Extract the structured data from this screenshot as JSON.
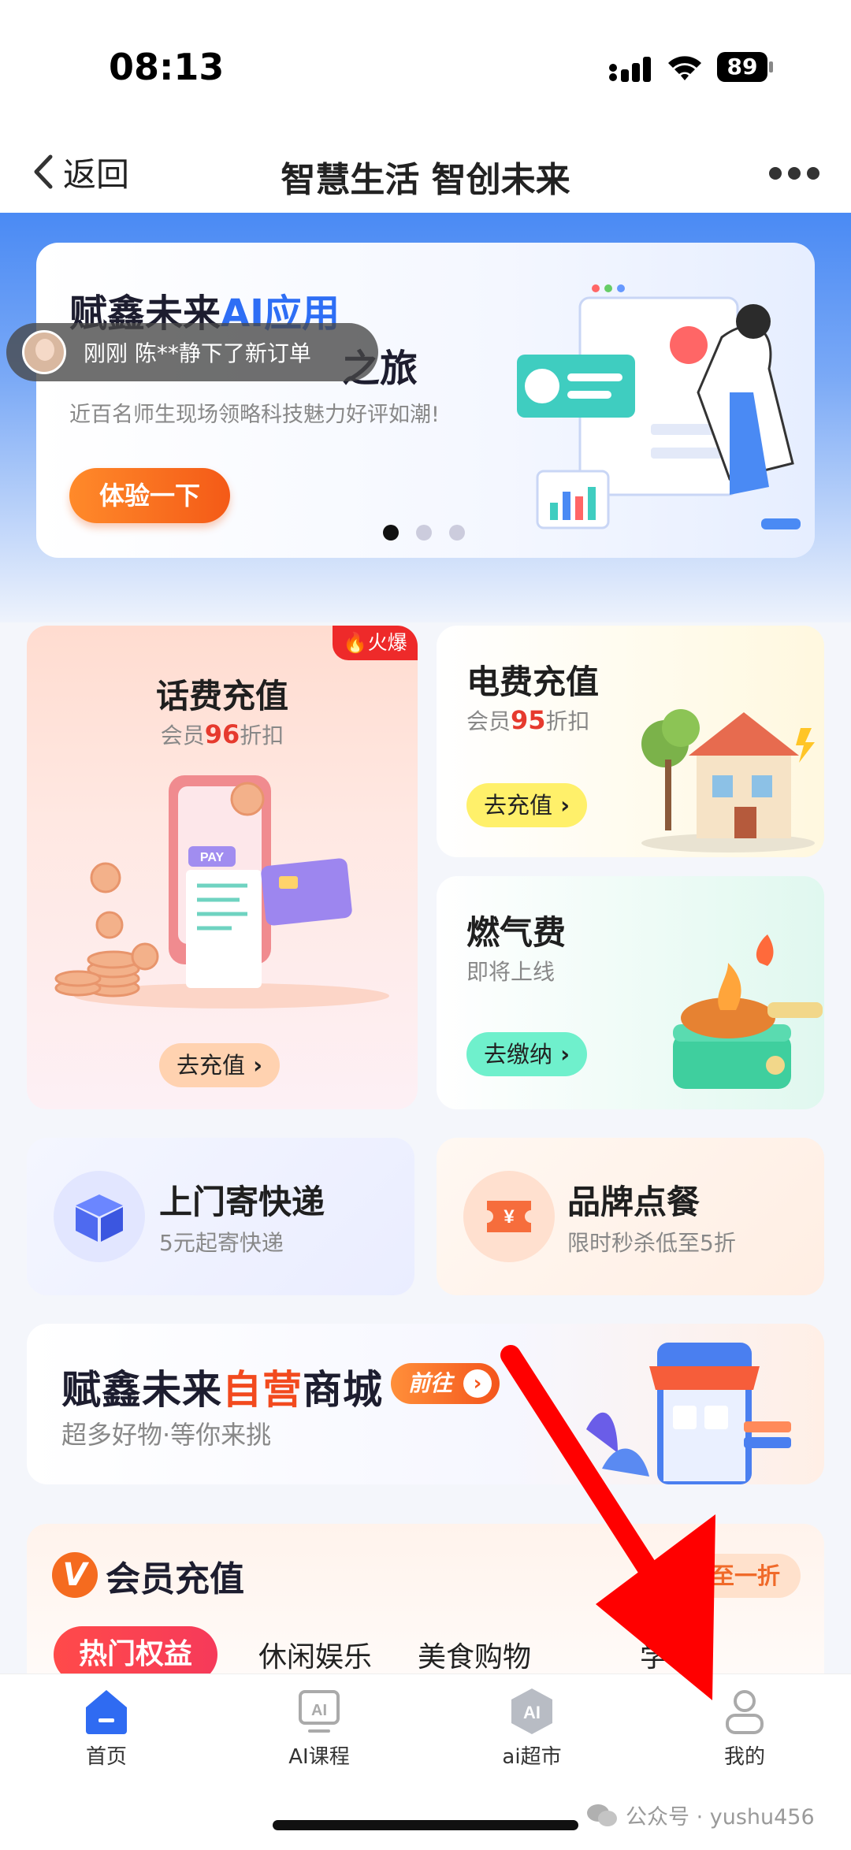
{
  "status": {
    "time": "08:13",
    "battery": "89"
  },
  "nav": {
    "back_label": "返回",
    "title": "智慧生活 智创未来"
  },
  "banner": {
    "title_prefix": "赋鑫未来",
    "title_highlight": "AI应用",
    "title_line2": "之旅",
    "subtitle": "近百名师生现场领略科技魅力好评如潮!",
    "button": "体验一下"
  },
  "toast": {
    "text": "刚刚  陈**静下了新订单"
  },
  "cards": {
    "phone": {
      "badge": "火爆",
      "title": "话费充值",
      "sub_prefix": "会员",
      "sub_num": "96",
      "sub_suffix": "折扣",
      "button": "去充值"
    },
    "electric": {
      "title": "电费充值",
      "sub_prefix": "会员",
      "sub_num": "95",
      "sub_suffix": "折扣",
      "button": "去充值"
    },
    "gas": {
      "title": "燃气费",
      "sub": "即将上线",
      "button": "去缴纳"
    },
    "express": {
      "title": "上门寄快递",
      "sub": "5元起寄快递"
    },
    "food": {
      "title": "品牌点餐",
      "sub": "限时秒杀低至5折"
    }
  },
  "mall": {
    "title_prefix": "赋鑫未来",
    "title_highlight": "自营",
    "title_suffix": "商城",
    "button": "前往",
    "subtitle": "超多好物·等你来挑"
  },
  "member": {
    "title": "会员充值",
    "tag": "低至一折",
    "tabs": [
      "热门权益",
      "休闲娱乐",
      "美食购物",
      "学习"
    ]
  },
  "tabbar": [
    {
      "label": "首页",
      "icon": "home-icon"
    },
    {
      "label": "AI课程",
      "icon": "ai-course-icon"
    },
    {
      "label": "ai超市",
      "icon": "ai-market-icon"
    },
    {
      "label": "我的",
      "icon": "profile-icon"
    }
  ],
  "watermark": "公众号 · yushu456",
  "colors": {
    "accent": "#2e6ef5",
    "orange": "#f4551c",
    "red": "#ee2a2a",
    "arrow": "#ff0000"
  }
}
